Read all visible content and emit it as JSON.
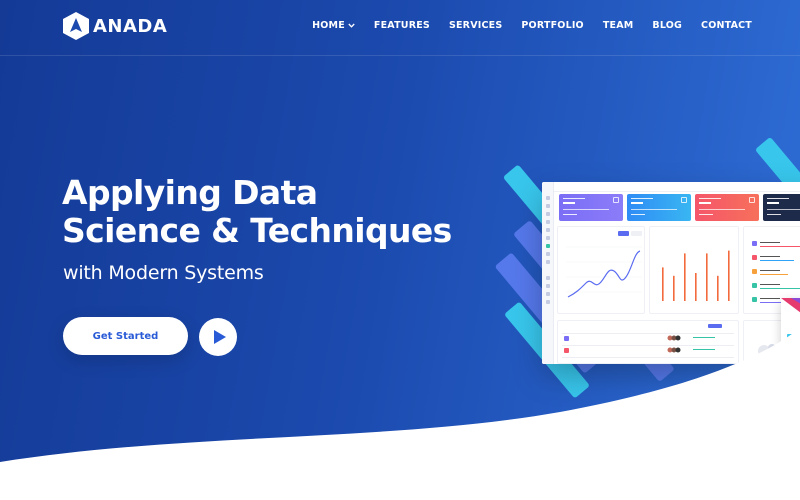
{
  "header": {
    "brand": "ANADA",
    "menu": [
      {
        "label": "HOME",
        "has_dropdown": true
      },
      {
        "label": "FEATURES"
      },
      {
        "label": "SERVICES"
      },
      {
        "label": "PORTFOLIO"
      },
      {
        "label": "TEAM"
      },
      {
        "label": "BLOG"
      },
      {
        "label": "CONTACT"
      }
    ]
  },
  "hero": {
    "title_line1": "Applying Data",
    "title_line2": "Science & Techniques",
    "subtitle": "with Modern Systems",
    "cta_label": "Get Started",
    "play_icon": "play-icon"
  },
  "dashboard_mockup": {
    "stat_colors": [
      "#7b6ef6",
      "#2fa3f5",
      "#f5566a",
      "#1e2a4a"
    ],
    "sales_chart_type": "line",
    "orders_chart_type": "bar",
    "orders_bar_levels": [
      0.6,
      0.45,
      0.85,
      0.5,
      0.85,
      0.45,
      0.9
    ]
  },
  "colors": {
    "accent": "#2a5bd7",
    "cyan": "#38c6ec",
    "pink": "#ec4f79",
    "background": "#1b49ad"
  }
}
